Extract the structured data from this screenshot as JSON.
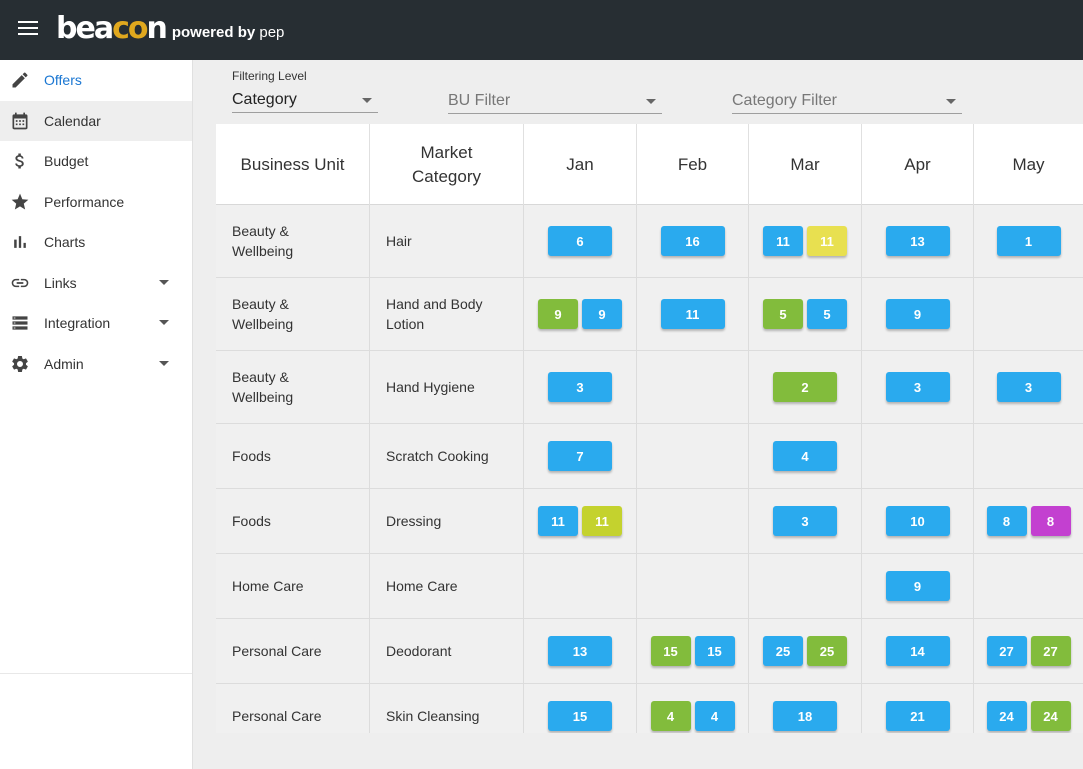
{
  "brand": {
    "logo_part1": "bea",
    "logo_part2": "co",
    "logo_part3": "n",
    "powered": "powered by",
    "pep": "pep",
    "gold": "#e0a81e"
  },
  "sidebar": {
    "items": [
      {
        "label": "Offers",
        "icon": "pencil-icon",
        "selected": true
      },
      {
        "label": "Calendar",
        "icon": "calendar-icon",
        "active": true
      },
      {
        "label": "Budget",
        "icon": "dollar-icon"
      },
      {
        "label": "Performance",
        "icon": "star-icon"
      },
      {
        "label": "Charts",
        "icon": "bar-chart-icon"
      },
      {
        "label": "Links",
        "icon": "link-icon",
        "expandable": true
      },
      {
        "label": "Integration",
        "icon": "list-icon",
        "expandable": true
      },
      {
        "label": "Admin",
        "icon": "gear-icon",
        "expandable": true
      }
    ]
  },
  "filters": {
    "level_label": "Filtering Level",
    "level_value": "Category",
    "bu_placeholder": "BU Filter",
    "category_placeholder": "Category Filter"
  },
  "table": {
    "headers": {
      "bu": "Business Unit",
      "category": "Market Category"
    },
    "months": [
      "Jan",
      "Feb",
      "Mar",
      "Apr",
      "May"
    ],
    "colors": {
      "blue": "#2aaaee",
      "green": "#82bc3c",
      "yellow": "#e8e050",
      "lime": "#c4d22e",
      "purple": "#c340d0"
    },
    "rows": [
      {
        "bu": "Beauty & Wellbeing",
        "category": "Hair",
        "cells": [
          [
            [
              "6",
              "blue"
            ]
          ],
          [
            [
              "16",
              "blue"
            ]
          ],
          [
            [
              "11",
              "blue"
            ],
            [
              "11",
              "yellow"
            ]
          ],
          [
            [
              "13",
              "blue"
            ]
          ],
          [
            [
              "1",
              "blue"
            ]
          ]
        ]
      },
      {
        "bu": "Beauty & Wellbeing",
        "category": "Hand and Body Lotion",
        "cells": [
          [
            [
              "9",
              "green"
            ],
            [
              "9",
              "blue"
            ]
          ],
          [
            [
              "11",
              "blue"
            ]
          ],
          [
            [
              "5",
              "green"
            ],
            [
              "5",
              "blue"
            ]
          ],
          [
            [
              "9",
              "blue"
            ]
          ],
          []
        ]
      },
      {
        "bu": "Beauty & Wellbeing",
        "category": "Hand Hygiene",
        "cells": [
          [
            [
              "3",
              "blue"
            ]
          ],
          [],
          [
            [
              "2",
              "green"
            ]
          ],
          [
            [
              "3",
              "blue"
            ]
          ],
          [
            [
              "3",
              "blue"
            ]
          ]
        ]
      },
      {
        "bu": "Foods",
        "category": "Scratch Cooking",
        "cells": [
          [
            [
              "7",
              "blue"
            ]
          ],
          [],
          [
            [
              "4",
              "blue"
            ]
          ],
          [],
          []
        ]
      },
      {
        "bu": "Foods",
        "category": "Dressing",
        "cells": [
          [
            [
              "11",
              "blue"
            ],
            [
              "11",
              "lime"
            ]
          ],
          [],
          [
            [
              "3",
              "blue"
            ]
          ],
          [
            [
              "10",
              "blue"
            ]
          ],
          [
            [
              "8",
              "blue"
            ],
            [
              "8",
              "purple"
            ]
          ]
        ]
      },
      {
        "bu": "Home Care",
        "category": "Home Care",
        "cells": [
          [],
          [],
          [],
          [
            [
              "9",
              "blue"
            ]
          ],
          []
        ]
      },
      {
        "bu": "Personal Care",
        "category": "Deodorant",
        "cells": [
          [
            [
              "13",
              "blue"
            ]
          ],
          [
            [
              "15",
              "green"
            ],
            [
              "15",
              "blue"
            ]
          ],
          [
            [
              "25",
              "blue"
            ],
            [
              "25",
              "green"
            ]
          ],
          [
            [
              "14",
              "blue"
            ]
          ],
          [
            [
              "27",
              "blue"
            ],
            [
              "27",
              "green"
            ]
          ]
        ]
      },
      {
        "bu": "Personal Care",
        "category": "Skin Cleansing",
        "cells": [
          [
            [
              "15",
              "blue"
            ]
          ],
          [
            [
              "4",
              "green"
            ],
            [
              "4",
              "blue"
            ]
          ],
          [
            [
              "18",
              "blue"
            ]
          ],
          [
            [
              "21",
              "blue"
            ]
          ],
          [
            [
              "24",
              "blue"
            ],
            [
              "24",
              "green"
            ]
          ]
        ]
      }
    ]
  }
}
